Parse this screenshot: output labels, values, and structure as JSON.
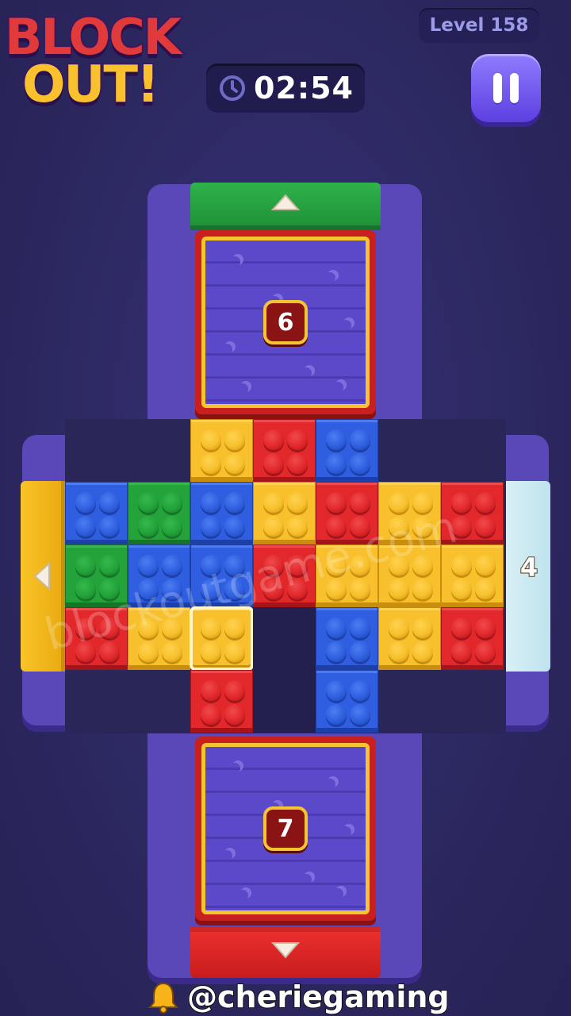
{
  "header": {
    "logo_line1": "BLOCK",
    "logo_line2": "OUT!",
    "level_label": "Level 158",
    "timer": "02:54",
    "pause_icon": "pause-icon",
    "clock_icon": "clock-icon"
  },
  "gates": {
    "top": {
      "color": "#22a43f",
      "direction": "up"
    },
    "bottom": {
      "color": "#e02525",
      "direction": "down"
    },
    "left": {
      "color": "#f4b81d",
      "direction": "left"
    },
    "right": {
      "color": "#cbe8f1",
      "count": "4"
    }
  },
  "doors": {
    "top_count": "6",
    "bottom_count": "7"
  },
  "palette": {
    "red": "#e2282b",
    "yellow": "#f7c02c",
    "blue": "#2f5fe0",
    "green": "#23a33a"
  },
  "grid": [
    [
      null,
      null,
      "yellow",
      "red",
      "blue",
      null,
      null
    ],
    [
      "blue",
      "green",
      "blue",
      "yellow",
      "red",
      "yellow",
      "red"
    ],
    [
      "green",
      "blue",
      "blue",
      "red",
      "yellow",
      "yellow",
      "yellow"
    ],
    [
      "red",
      "yellow",
      "yellow-selected",
      "hole",
      "blue",
      "yellow",
      "red"
    ],
    [
      null,
      null,
      "red",
      "hole",
      "blue",
      null,
      null
    ]
  ],
  "watermark": "blockoutgame.com",
  "footer": {
    "handle": "@cheriegaming",
    "bell_icon": "bell-icon"
  }
}
